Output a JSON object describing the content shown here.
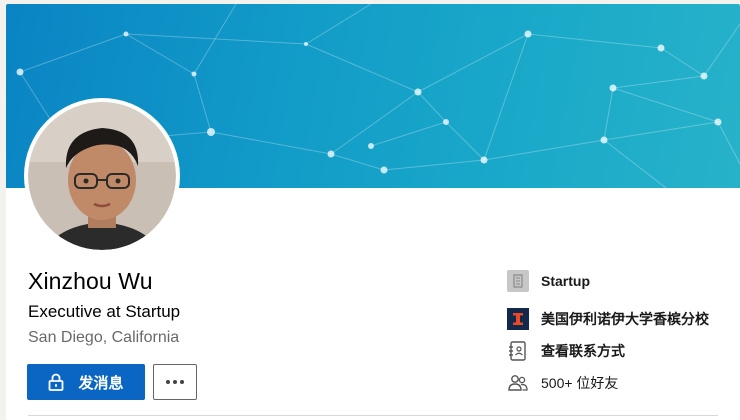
{
  "profile": {
    "name": "Xinzhou Wu",
    "headline": "Executive at Startup",
    "location": "San Diego, California"
  },
  "actions": {
    "message_label": "发消息"
  },
  "sidebar": {
    "company": "Startup",
    "school": "美国伊利诺伊大学香槟分校",
    "contact": "查看联系方式",
    "connections": "500+ 位好友"
  },
  "icons": {
    "company": "building-icon",
    "school": "school-logo-icon",
    "contact": "address-book-icon",
    "connections": "people-icon",
    "message": "lock-icon",
    "more": "more-dots-icon"
  },
  "colors": {
    "primary": "#0a66c2",
    "banner_start": "#0a84c4",
    "banner_end": "#27b2c9",
    "school_logo_bg": "#13294b",
    "school_logo_fg": "#e84a27"
  }
}
